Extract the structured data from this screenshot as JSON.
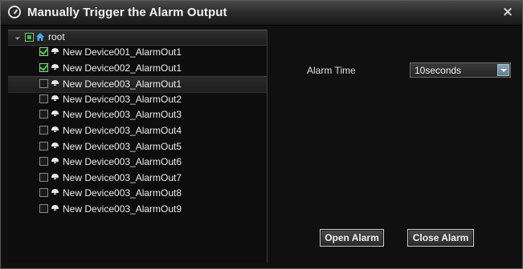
{
  "window": {
    "title": "Manually Trigger the Alarm Output",
    "close_glyph": "×",
    "title_icon": "clock-circle-icon"
  },
  "tree": {
    "root": {
      "label": "root",
      "check_state": "partial",
      "icon": "home-icon"
    },
    "items": [
      {
        "label": "New Device001_AlarmOut1",
        "checked": true,
        "selected": false
      },
      {
        "label": "New Device002_AlarmOut1",
        "checked": true,
        "selected": false
      },
      {
        "label": "New Device003_AlarmOut1",
        "checked": false,
        "selected": true
      },
      {
        "label": "New Device003_AlarmOut2",
        "checked": false,
        "selected": false
      },
      {
        "label": "New Device003_AlarmOut3",
        "checked": false,
        "selected": false
      },
      {
        "label": "New Device003_AlarmOut4",
        "checked": false,
        "selected": false
      },
      {
        "label": "New Device003_AlarmOut5",
        "checked": false,
        "selected": false
      },
      {
        "label": "New Device003_AlarmOut6",
        "checked": false,
        "selected": false
      },
      {
        "label": "New Device003_AlarmOut7",
        "checked": false,
        "selected": false
      },
      {
        "label": "New Device003_AlarmOut8",
        "checked": false,
        "selected": false
      },
      {
        "label": "New Device003_AlarmOut9",
        "checked": false,
        "selected": false
      }
    ]
  },
  "settings": {
    "alarm_time_label": "Alarm Time",
    "alarm_time_value": "10seconds"
  },
  "buttons": {
    "open_label": "Open Alarm",
    "close_label": "Close Alarm"
  },
  "colors": {
    "check_green": "#3fd23f",
    "dropdown_arrow": "#6f8ea2"
  }
}
